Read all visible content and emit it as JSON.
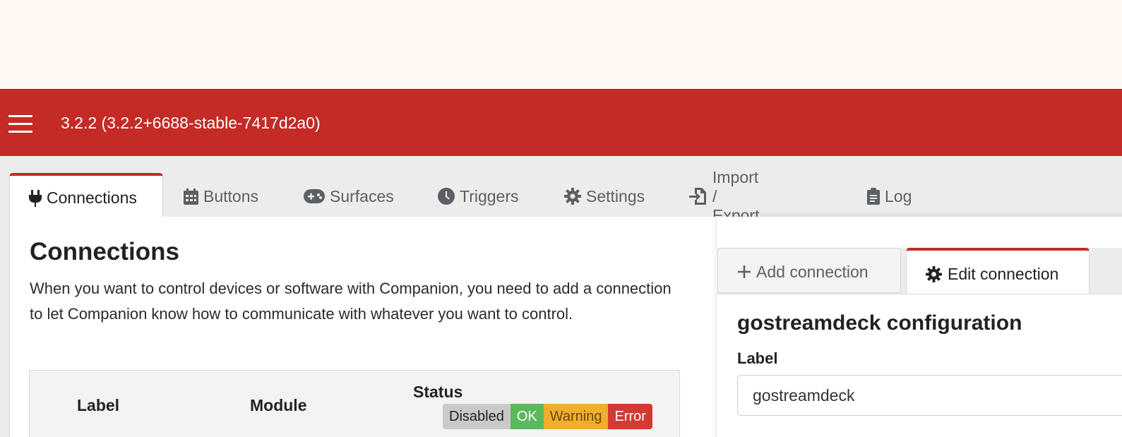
{
  "header": {
    "version": "3.2.2 (3.2.2+6688-stable-7417d2a0)",
    "menu_icon": "hamburger-menu-icon",
    "color": "#c42a26"
  },
  "tabs": [
    {
      "label": "Connections",
      "icon": "plug-icon",
      "active": true
    },
    {
      "label": "Buttons",
      "icon": "calendar-grid-icon"
    },
    {
      "label": "Surfaces",
      "icon": "gamepad-icon"
    },
    {
      "label": "Triggers",
      "icon": "clock-icon"
    },
    {
      "label": "Settings",
      "icon": "gear-icon"
    },
    {
      "label": "Import / Export",
      "icon": "file-import-icon"
    },
    {
      "label": "Log",
      "icon": "clipboard-icon"
    }
  ],
  "connections": {
    "title": "Connections",
    "description": "When you want to control devices or software with Companion, you need to add a connection to let Companion know how to communicate with whatever you want to control.",
    "table": {
      "col_label": "Label",
      "col_module": "Module",
      "col_status": "Status",
      "legend": [
        {
          "label": "Disabled",
          "bg": "#c9c9c9",
          "fg": "#222222"
        },
        {
          "label": "OK",
          "bg": "#5cb85c",
          "fg": "#ffffff"
        },
        {
          "label": "Warning",
          "bg": "#f0ad2e",
          "fg": "#6a4a00"
        },
        {
          "label": "Error",
          "bg": "#d13a32",
          "fg": "#ffffff"
        }
      ]
    }
  },
  "right_panel": {
    "add_tab": "Add connection",
    "edit_tab": "Edit connection",
    "config_title": "gostreamdeck configuration",
    "label_field": {
      "label": "Label",
      "value": "gostreamdeck"
    }
  }
}
